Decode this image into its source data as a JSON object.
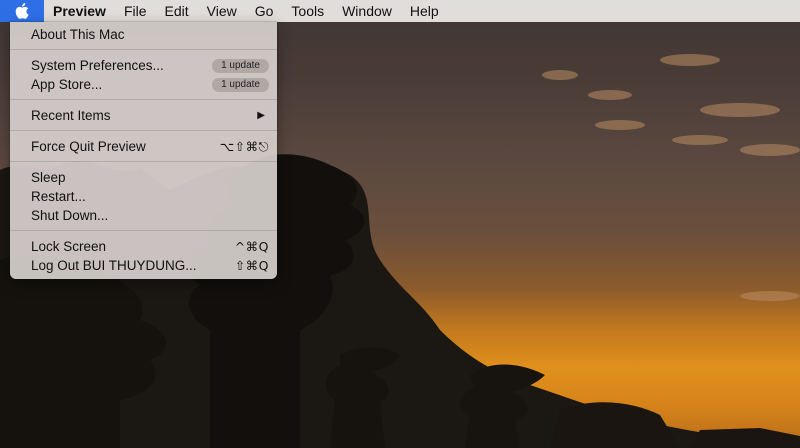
{
  "menubar": {
    "apple_icon": "apple-logo-icon",
    "accent_color": "#2f6fe6",
    "items": [
      "Preview",
      "File",
      "Edit",
      "View",
      "Go",
      "Tools",
      "Window",
      "Help"
    ]
  },
  "apple_menu": {
    "about": "About This Mac",
    "system_preferences": {
      "label": "System Preferences...",
      "badge": "1 update"
    },
    "app_store": {
      "label": "App Store...",
      "badge": "1 update"
    },
    "recent_items": {
      "label": "Recent Items",
      "arrow": "▶"
    },
    "force_quit": {
      "label": "Force Quit Preview",
      "shortcut": "⌥⇧⌘⎋"
    },
    "sleep": "Sleep",
    "restart": "Restart...",
    "shut_down": "Shut Down...",
    "lock_screen": {
      "label": "Lock Screen",
      "shortcut": "^⌘Q"
    },
    "log_out": {
      "label": "Log Out BUI THUYDUNG...",
      "shortcut": "⇧⌘Q"
    }
  }
}
